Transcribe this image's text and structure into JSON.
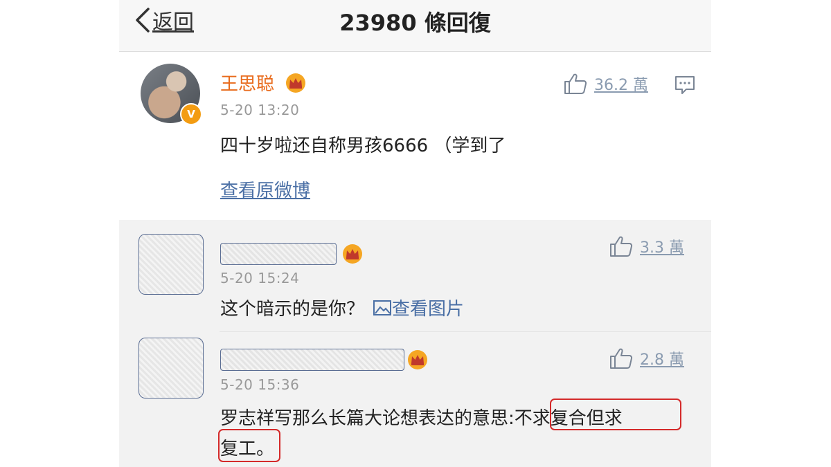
{
  "header": {
    "back_label": "返回",
    "title": "23980 條回復"
  },
  "main_comment": {
    "username": "王思聪",
    "verified": "V",
    "time": "5-20 13:20",
    "text": "四十岁啦还自称男孩6666 （学到了",
    "likes": "36.2 萬",
    "view_original": "查看原微博"
  },
  "replies": [
    {
      "time": "5-20 15:24",
      "text": "这个暗示的是你？",
      "pic_link": "查看图片",
      "likes": "3.3 萬"
    },
    {
      "time": "5-20 15:36",
      "text_line1": "罗志祥写那么长篇大论想表达的意思:不求复合但求",
      "text_line2": "复工。",
      "likes": "2.8 萬"
    }
  ],
  "colors": {
    "username": "#e86a1b",
    "link": "#4a6fa5",
    "highlight": "#d42a2a",
    "crown": "#f5a623"
  },
  "icons": [
    "chevron-left-icon",
    "crown-icon",
    "thumbs-up-icon",
    "comment-icon",
    "image-icon"
  ]
}
